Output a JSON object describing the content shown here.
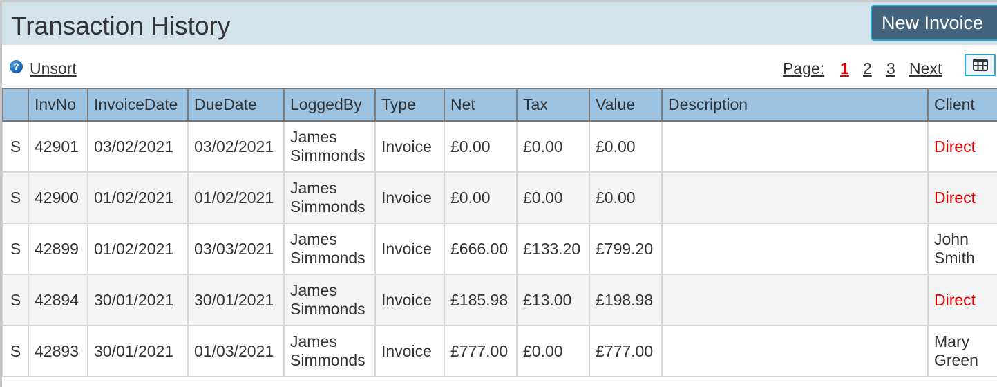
{
  "header": {
    "title": "Transaction History",
    "new_invoice_label": "New Invoice"
  },
  "toolbar": {
    "help_icon": "question-circle-icon",
    "unsort_label": "Unsort",
    "pager": {
      "label": "Page:",
      "pages": [
        "1",
        "2",
        "3"
      ],
      "current_page": "1",
      "next_label": "Next"
    },
    "grid_icon": "table-grid-icon"
  },
  "table": {
    "columns": [
      "",
      "InvNo",
      "InvoiceDate",
      "DueDate",
      "LoggedBy",
      "Type",
      "Net",
      "Tax",
      "Value",
      "Description",
      "Client"
    ],
    "rows": [
      {
        "sel": "S",
        "invno": "42901",
        "invoice_date": "03/02/2021",
        "due_date": "03/02/2021",
        "logged_by_first": "James",
        "logged_by_last": "Simmonds",
        "type": "Invoice",
        "net": "£0.00",
        "tax": "£0.00",
        "value": "£0.00",
        "description": "",
        "client_line1": "Direct",
        "client_line2": "",
        "client_color": "#e80000"
      },
      {
        "sel": "S",
        "invno": "42900",
        "invoice_date": "01/02/2021",
        "due_date": "01/02/2021",
        "logged_by_first": "James",
        "logged_by_last": "Simmonds",
        "type": "Invoice",
        "net": "£0.00",
        "tax": "£0.00",
        "value": "£0.00",
        "description": "",
        "client_line1": "Direct",
        "client_line2": "",
        "client_color": "#e80000"
      },
      {
        "sel": "S",
        "invno": "42899",
        "invoice_date": "01/02/2021",
        "due_date": "03/03/2021",
        "logged_by_first": "James",
        "logged_by_last": "Simmonds",
        "type": "Invoice",
        "net": "£666.00",
        "tax": "£133.20",
        "value": "£799.20",
        "description": "",
        "client_line1": "John",
        "client_line2": "Smith",
        "client_color": "#333333"
      },
      {
        "sel": "S",
        "invno": "42894",
        "invoice_date": "30/01/2021",
        "due_date": "30/01/2021",
        "logged_by_first": "James",
        "logged_by_last": "Simmonds",
        "type": "Invoice",
        "net": "£185.98",
        "tax": "£13.00",
        "value": "£198.98",
        "description": "",
        "client_line1": "Direct",
        "client_line2": "",
        "client_color": "#e80000"
      },
      {
        "sel": "S",
        "invno": "42893",
        "invoice_date": "30/01/2021",
        "due_date": "01/03/2021",
        "logged_by_first": "James",
        "logged_by_last": "Simmonds",
        "type": "Invoice",
        "net": "£777.00",
        "tax": "£0.00",
        "value": "£777.00",
        "description": "",
        "client_line1": "Mary",
        "client_line2": "Green",
        "client_color": "#333333"
      }
    ]
  },
  "colors": {
    "header_bg": "#d3e3ec",
    "button_bg": "#44637c",
    "button_border": "#2aa6d6",
    "table_header_bg": "#9dc3e2",
    "current_page": "#e80000",
    "direct_client": "#e80000"
  }
}
